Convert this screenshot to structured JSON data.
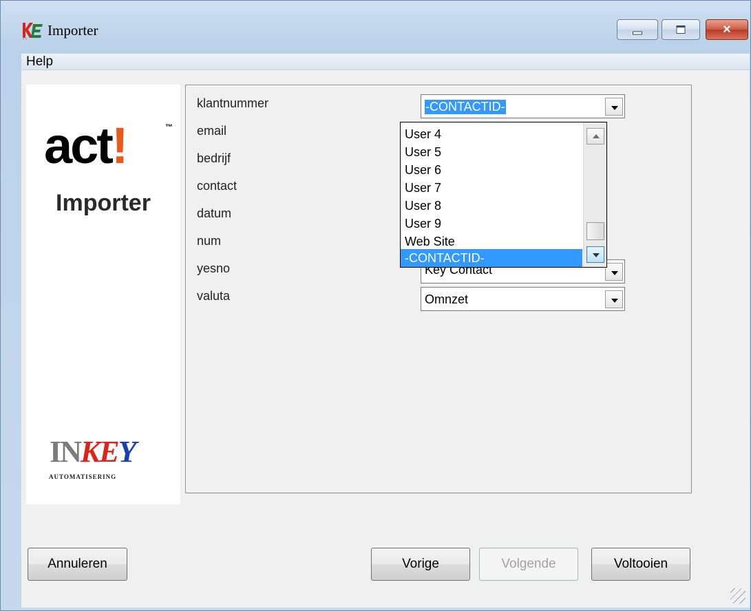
{
  "window": {
    "title": "Importer",
    "controls": {
      "minimize": "minimize",
      "maximize": "maximize",
      "close": "×"
    }
  },
  "menu": {
    "items": [
      "Help"
    ]
  },
  "logo": {
    "act_text": "act",
    "act_bang": "!",
    "trademark": "™",
    "subtitle": "Importer",
    "company_in": "IN",
    "company_ke": "KE",
    "company_y": "Y",
    "company_sub": "AUTOMATISERING"
  },
  "fields": {
    "labels": [
      "klantnummer",
      "email",
      "bedrijf",
      "contact",
      "datum",
      "num",
      "yesno",
      "valuta"
    ],
    "combos": {
      "klantnummer": "-CONTACTID-",
      "yesno": "Key Contact",
      "valuta": "Omnzet"
    }
  },
  "dropdown": {
    "items": [
      "User 4",
      "User 5",
      "User 6",
      "User 7",
      "User 8",
      "User 9",
      "Web Site",
      "-CONTACTID-"
    ],
    "selected": "-CONTACTID-",
    "scroll_position": 0.93
  },
  "buttons": {
    "cancel": "Annuleren",
    "previous": "Vorige",
    "next": "Volgende",
    "finish": "Voltooien"
  },
  "colors": {
    "selection": "#3399ff",
    "act_accent": "#e85a1c"
  }
}
